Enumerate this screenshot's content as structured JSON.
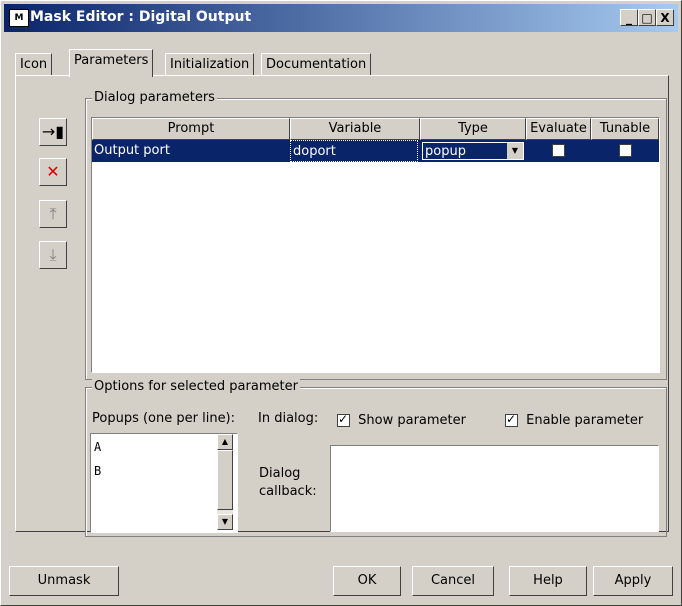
{
  "window": {
    "title": "Mask Editor : Digital Output",
    "minimize": "_",
    "maximize": "□",
    "close": "X"
  },
  "tabs": [
    "Icon",
    "Parameters",
    "Initialization",
    "Documentation"
  ],
  "dialog_parameters": {
    "legend": "Dialog parameters",
    "columns": [
      "Prompt",
      "Variable",
      "Type",
      "Evaluate",
      "Tunable"
    ],
    "rows": [
      {
        "prompt": "Output port",
        "variable": "doport",
        "type": "popup",
        "evaluate": false,
        "tunable": false
      }
    ],
    "side_icons": [
      "add-parameter-icon",
      "delete-parameter-icon",
      "move-up-icon",
      "move-down-icon"
    ]
  },
  "options": {
    "legend": "Options for selected parameter",
    "popups_label": "Popups (one per line):",
    "popups_items": [
      "A",
      "B"
    ],
    "in_dialog_label": "In dialog:",
    "show_parameter_label": "Show parameter",
    "show_parameter_checked": true,
    "enable_parameter_label": "Enable parameter",
    "enable_parameter_checked": true,
    "dialog_callback_label_1": "Dialog",
    "dialog_callback_label_2": "callback:",
    "dialog_callback_value": ""
  },
  "buttons": {
    "unmask": "Unmask",
    "ok": "OK",
    "cancel": "Cancel",
    "help": "Help",
    "apply": "Apply"
  },
  "colors": {
    "titlebar": "#0a246a",
    "selection": "#0a246a",
    "face": "#d4d0c8"
  }
}
